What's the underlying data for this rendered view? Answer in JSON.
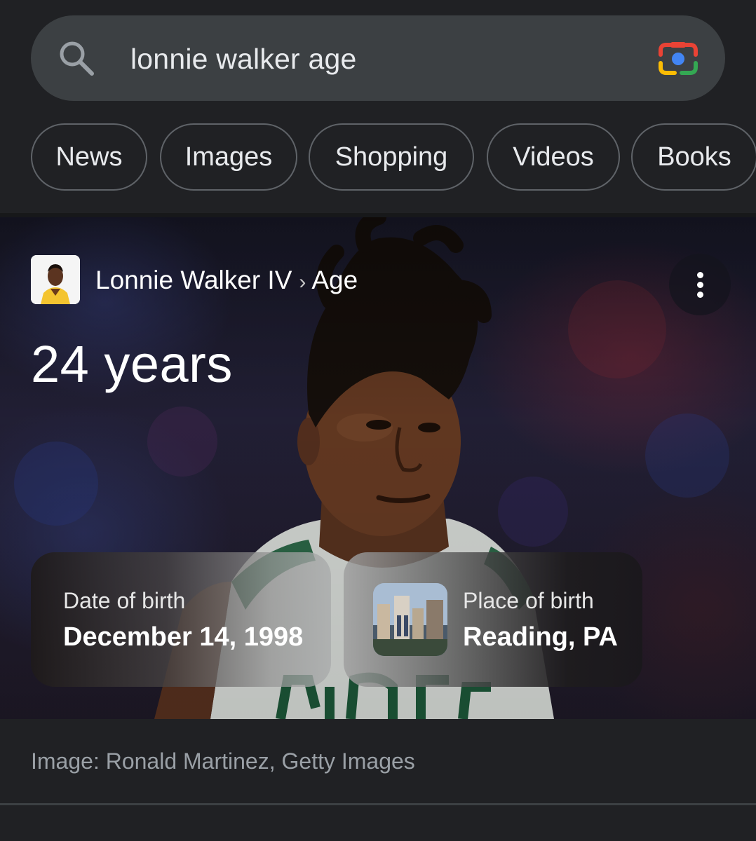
{
  "search": {
    "query": "lonnie walker age",
    "search_icon": "search-icon",
    "lens_icon": "google-lens-camera-icon"
  },
  "chips": [
    {
      "label": "News"
    },
    {
      "label": "Images"
    },
    {
      "label": "Shopping"
    },
    {
      "label": "Videos"
    },
    {
      "label": "Books"
    }
  ],
  "knowledge_panel": {
    "entity": "Lonnie Walker IV",
    "separator": "›",
    "attribute": "Age",
    "answer": "24 years",
    "more_icon": "more-vert-icon",
    "date_of_birth": {
      "label": "Date of birth",
      "value": "December 14, 1998"
    },
    "place_of_birth": {
      "label": "Place of birth",
      "value": "Reading, PA"
    },
    "image_caption": "Image: Ronald Martinez, Getty Images"
  },
  "colors": {
    "background": "#202124",
    "search_bar": "#3c4043",
    "chip_border": "#5f6368",
    "caption_text": "#9aa0a6"
  }
}
